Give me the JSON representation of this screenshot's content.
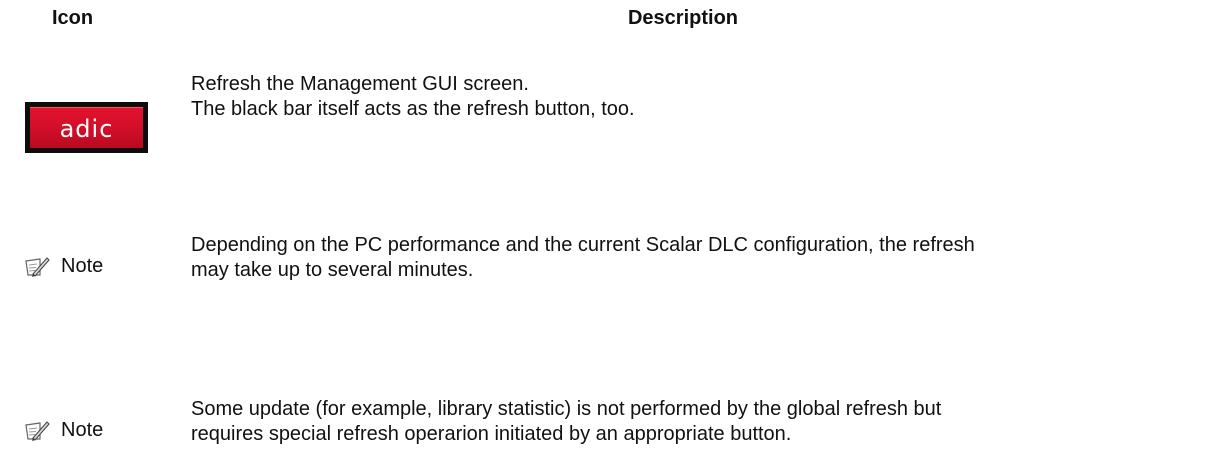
{
  "table": {
    "header_icon": "Icon",
    "header_description": "Description"
  },
  "rows": [
    {
      "icon": "adic-logo",
      "icon_text": "adic",
      "lines": [
        "Refresh the Management GUI screen.",
        "The black bar itself acts as the refresh button, too."
      ]
    }
  ],
  "notes": [
    {
      "icon": "note-pencil-icon",
      "label": "Note",
      "lines": [
        "Depending on the PC performance and the current Scalar DLC configuration, the refresh",
        "may take up to several minutes."
      ]
    },
    {
      "icon": "note-pencil-icon",
      "label": "Note",
      "lines": [
        "Some update (for example, library statistic) is not performed by the global refresh but",
        "requires special refresh operarion initiated by an appropriate button."
      ]
    }
  ],
  "colors": {
    "logo_red": "#d40f2a",
    "logo_frame": "#0c0c0c"
  }
}
